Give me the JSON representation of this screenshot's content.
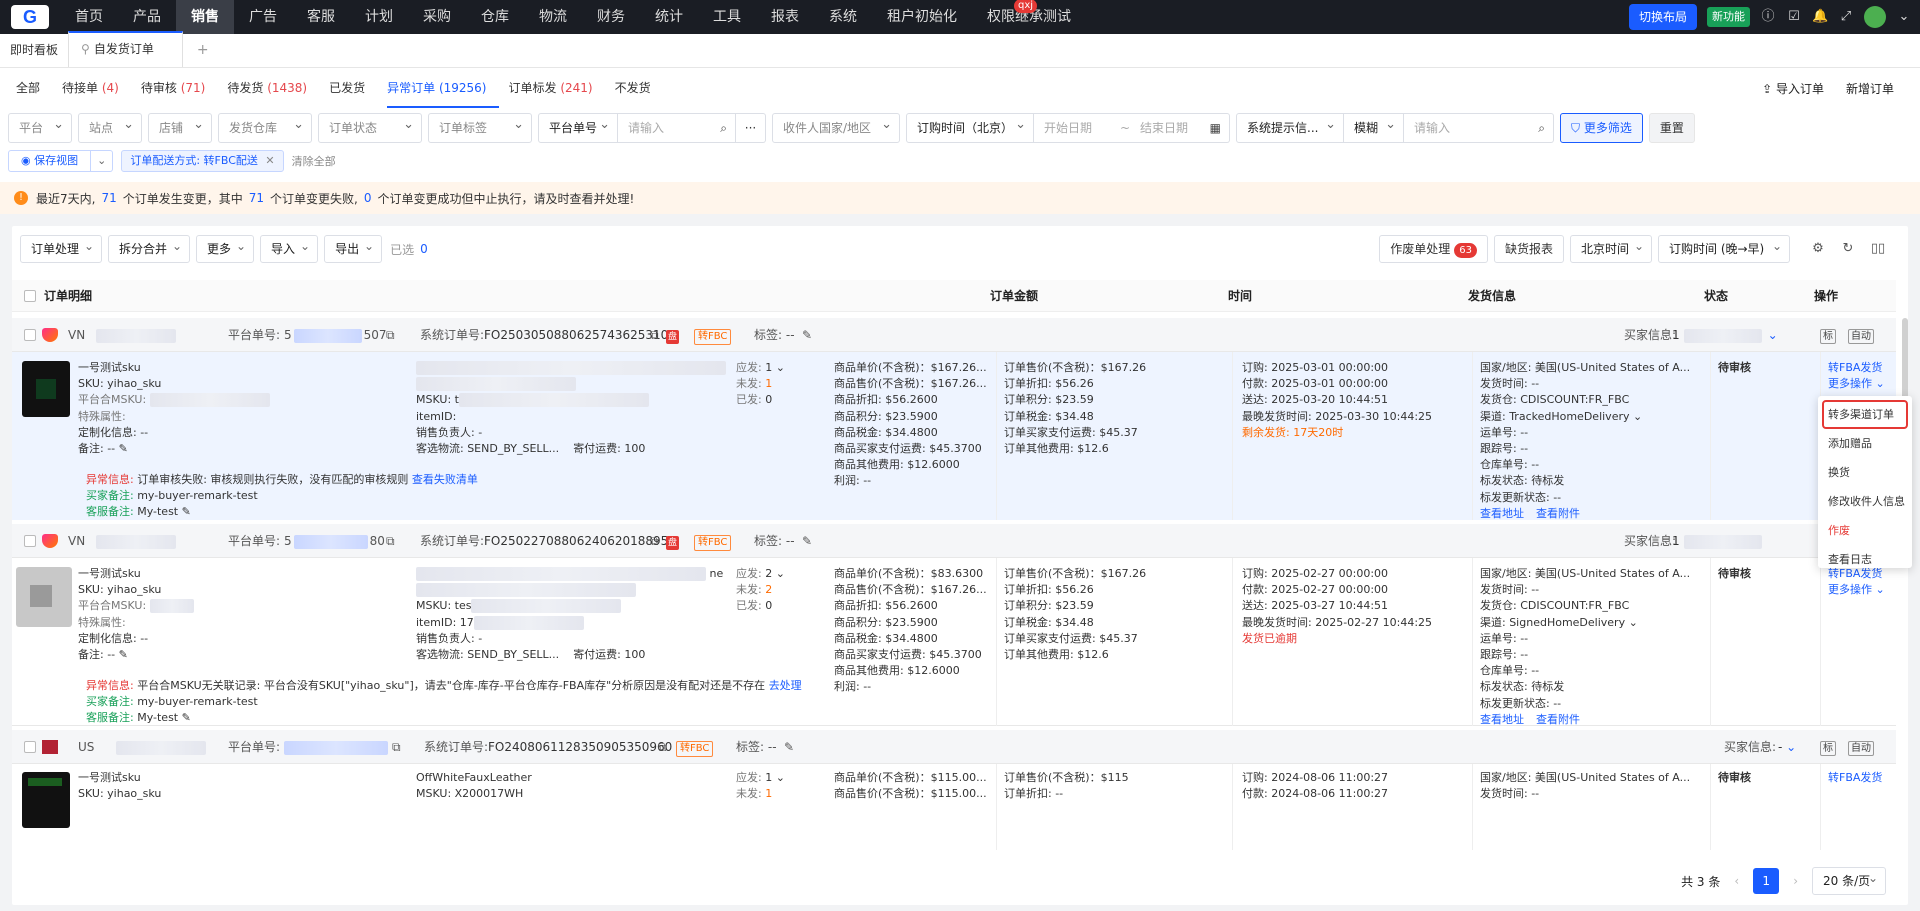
{
  "nav": {
    "items": [
      "首页",
      "产品",
      "销售",
      "广告",
      "客服",
      "计划",
      "采购",
      "仓库",
      "物流",
      "财务",
      "统计",
      "工具",
      "报表",
      "系统",
      "租户初始化",
      "权限继承测试"
    ],
    "badge": "qxj",
    "switch_layout": "切换布局",
    "new_feature": "新功能"
  },
  "tabs": {
    "items": [
      "即时看板",
      "自发货订单"
    ],
    "add": "+"
  },
  "status_tabs": {
    "items": [
      {
        "label": "全部",
        "count": ""
      },
      {
        "label": "待接单",
        "count": "(4)"
      },
      {
        "label": "待审核",
        "count": "(71)"
      },
      {
        "label": "待发货",
        "count": "(1438)"
      },
      {
        "label": "已发货",
        "count": ""
      },
      {
        "label": "异常订单",
        "count": "(19256)"
      },
      {
        "label": "订单标发",
        "count": "(241)"
      },
      {
        "label": "不发货",
        "count": ""
      }
    ],
    "import_order": "导入订单",
    "new_order": "新增订单"
  },
  "filters": {
    "platform": "平台",
    "site": "站点",
    "shop": "店铺",
    "warehouse": "发货仓库",
    "order_status": "订单状态",
    "order_tag": "订单标签",
    "platform_no": "平台单号",
    "input_ph": "请输入",
    "receiver": "收件人国家/地区",
    "order_time": "订购时间（北京）",
    "start_date": "开始日期",
    "to": "~",
    "end_date": "结束日期",
    "sys_tip": "系统提示信...",
    "fuzzy": "模糊",
    "more_filter": "更多筛选",
    "reset": "重置",
    "save_view": "保存视图",
    "active_tag": "订单配送方式: 转FBC配送",
    "clear_all": "清除全部"
  },
  "notice": {
    "p1": "最近7天内,",
    "n1": "71",
    "p2": "个订单发生变更，其中",
    "n2": "71",
    "p3": "个订单变更失败,",
    "n3": "0",
    "p4": "个订单变更成功但中止执行，请及时查看并处理!"
  },
  "toolbar": {
    "order_process": "订单处理",
    "split_merge": "拆分合并",
    "more": "更多",
    "import": "导入",
    "export": "导出",
    "selected": "已选",
    "selected_count": "0",
    "void_process": "作废单处理",
    "void_count": "63",
    "shortage": "缺货报表",
    "beijing_time": "北京时间",
    "sort_time": "订购时间 (晚→早)"
  },
  "table_head": {
    "detail": "订单明细",
    "amount": "订单金额",
    "time": "时间",
    "ship": "发货信息",
    "status": "状态",
    "action": "操作"
  },
  "orders": [
    {
      "country": "VN",
      "platform_no_lbl": "平台单号:",
      "pno_a": "5",
      "pno_b": "507",
      "sys_lbl": "系统订单号:",
      "sys_no": "FO2503050880625743625310",
      "fbc": "转FBC",
      "tag_lbl": "标签: --",
      "buyer_lbl": "买家信息:",
      "buyer_val": "1",
      "flag1": "标",
      "flag2": "自动",
      "name": "一号测试sku",
      "sku": "SKU:  yihao_sku",
      "pmsku": "平台合MSKU:",
      "special": "特殊属性:",
      "custom": "定制化信息:  --",
      "remark": "备注:  --",
      "msku": "MSKU:",
      "msku_v": "t",
      "itemid": "itemID:",
      "sales": "销售负责人:  -",
      "ship_method": "客选物流:  SEND_BY_SELL...",
      "post": "寄付运费:  100",
      "should": "应发:",
      "should_v": "1",
      "unsent": "未发:",
      "unsent_v": "1",
      "sent": "已发:",
      "sent_v": "0",
      "p1": "商品单价(不含税)：$167.26...",
      "p2": "商品售价(不含税)：$167.26...",
      "p3": "商品折扣:  $56.2600",
      "p4": "商品积分:  $23.5900",
      "p5": "商品税金:  $34.4800",
      "p6": "商品买家支付运费:  $45.3700",
      "p7": "商品其他费用:  $12.6000",
      "p8": "利润:  --",
      "a1": "订单售价(不含税)：$167.26",
      "a2": "订单折扣:  $56.26",
      "a3": "订单积分:  $23.59",
      "a4": "订单税金:  $34.48",
      "a5": "订单买家支付运费:  $45.37",
      "a6": "订单其他费用:  $12.6",
      "t1": "订购:  2025-03-01 00:00:00",
      "t2": "付款:  2025-03-01 00:00:00",
      "t3": "送达:  2025-03-20 10:44:51",
      "t4": "最晚发货时间:  2025-03-30 10:44:25",
      "t5": "剩余发货: 17天20时",
      "s1": "国家/地区:  美国(US-United States of A...",
      "s2": "发货时间:  --",
      "s3": "发货仓:  CDISCOUNT:FR_FBC",
      "s4": "渠道:  TrackedHomeDelivery",
      "s5": "运单号:  --",
      "s6": "跟踪号:  --",
      "s7": "仓库单号:  --",
      "s8": "标发状态:  待标发",
      "s9": "标发更新状态:  --",
      "view_addr": "查看地址",
      "view_attach": "查看附件",
      "status": "待审核",
      "action1": "转FBA发货",
      "action2": "更多操作",
      "err_lbl": "异常信息:",
      "err": "订单审核失败: 审核规则执行失败，没有匹配的审核规则",
      "err_link": "查看失败清单",
      "buyer_remark_lbl": "买家备注:",
      "buyer_remark": "my-buyer-remark-test",
      "cs_lbl": "客服备注:",
      "cs": "My-test"
    },
    {
      "country": "VN",
      "platform_no_lbl": "平台单号:",
      "pno_a": "5",
      "pno_b": "80",
      "sys_lbl": "系统订单号:",
      "sys_no": "FO2502270880624062018895",
      "fbc": "转FBC",
      "tag_lbl": "标签: --",
      "buyer_lbl": "买家信息:",
      "buyer_val": "1",
      "name": "一号测试sku",
      "sku": "SKU:  yihao_sku",
      "pmsku": "平台合MSKU:",
      "special": "特殊属性:",
      "custom": "定制化信息:  --",
      "remark": "备注:  --",
      "msku": "MSKU:",
      "msku_v": "tes",
      "itemid": "itemID:",
      "itemid_v": "17",
      "sales": "销售负责人:  -",
      "ship_method": "客选物流:  SEND_BY_SELL...",
      "post": "寄付运费:  100",
      "title_end": "ne",
      "should": "应发:",
      "should_v": "2",
      "unsent": "未发:",
      "unsent_v": "2",
      "sent": "已发:",
      "sent_v": "0",
      "p1": "商品单价(不含税)：$83.6300",
      "p2": "商品售价(不含税)：$167.26...",
      "p3": "商品折扣:  $56.2600",
      "p4": "商品积分:  $23.5900",
      "p5": "商品税金:  $34.4800",
      "p6": "商品买家支付运费:  $45.3700",
      "p7": "商品其他费用:  $12.6000",
      "p8": "利润:  --",
      "a1": "订单售价(不含税)：$167.26",
      "a2": "订单折扣:  $56.26",
      "a3": "订单积分:  $23.59",
      "a4": "订单税金:  $34.48",
      "a5": "订单买家支付运费:  $45.37",
      "a6": "订单其他费用:  $12.6",
      "t1": "订购:  2025-02-27 00:00:00",
      "t2": "付款:  2025-02-27 00:00:00",
      "t3": "送达:  2025-03-27 10:44:51",
      "t4": "最晚发货时间:  2025-02-27 10:44:25",
      "t5": "发货已逾期",
      "s1": "国家/地区:  美国(US-United States of A...",
      "s2": "发货时间:  --",
      "s3": "发货仓:  CDISCOUNT:FR_FBC",
      "s4": "渠道:  SignedHomeDelivery",
      "s5": "运单号:  --",
      "s6": "跟踪号:  --",
      "s7": "仓库单号:  --",
      "s8": "标发状态:  待标发",
      "s9": "标发更新状态:  --",
      "view_addr": "查看地址",
      "view_attach": "查看附件",
      "status": "待审核",
      "action1": "转FBA发货",
      "action2": "更多操作",
      "err_lbl": "异常信息:",
      "err": "平台合MSKU无关联记录: 平台合没有SKU[\"yihao_sku\"]，请去\"仓库-库存-平台仓库存-FBA库存\"分析原因是没有配对还是不存在",
      "err_link": "去处理",
      "buyer_remark_lbl": "买家备注:",
      "buyer_remark": "my-buyer-remark-test",
      "cs_lbl": "客服备注:",
      "cs": "My-test"
    },
    {
      "country": "US",
      "platform_no_lbl": "平台单号:",
      "pno_a": "",
      "pno_b": "",
      "sys_lbl": "系统订单号:",
      "sys_no": "FO2408061128350905350960",
      "fbc": "转FBC",
      "tag_lbl": "标签: --",
      "buyer_lbl": "买家信息:",
      "buyer_val": "-",
      "name": "一号测试sku",
      "sku": "SKU:  yihao_sku",
      "title": "OffWhiteFauxLeather",
      "msku": "MSKU:  X200017WH",
      "should": "应发:",
      "should_v": "1",
      "unsent": "未发:",
      "unsent_v": "1",
      "p1": "商品单价(不含税)：$115.00...",
      "p2": "商品售价(不含税)：$115.00...",
      "a1": "订单售价(不含税)：$115",
      "a2": "订单折扣:  --",
      "t1": "订购:  2024-08-06 11:00:27",
      "t2": "付款:  2024-08-06 11:00:27",
      "s1": "国家/地区:  美国(US-United States of A...",
      "s2": "发货时间:  --",
      "status": "待审核",
      "action1": "转FBA发货"
    }
  ],
  "dropdown": [
    "转多渠道订单",
    "添加赠品",
    "换货",
    "修改收件人信息",
    "作废",
    "查看日志"
  ],
  "pager": {
    "total": "共 3 条",
    "page": "1",
    "size": "20 条/页",
    "prev": "‹",
    "next": "›"
  }
}
